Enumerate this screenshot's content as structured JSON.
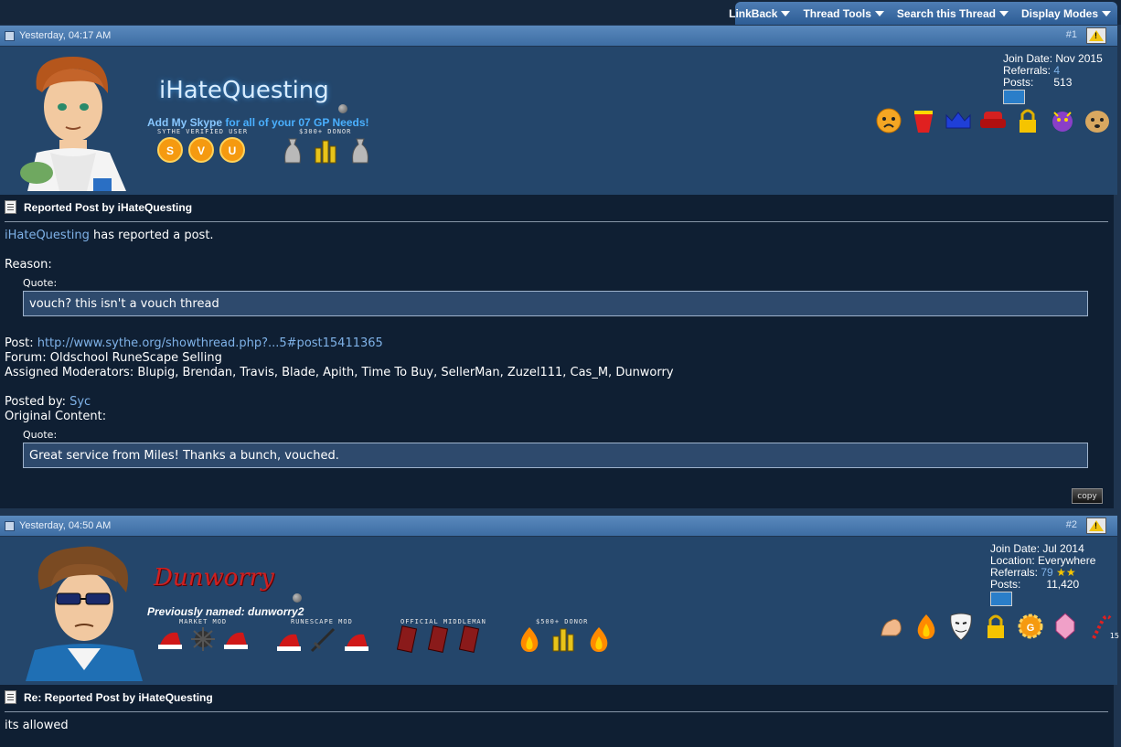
{
  "toolbar": {
    "items": [
      {
        "label": "LinkBack",
        "icon": "chevron-down-icon"
      },
      {
        "label": "Thread Tools",
        "icon": "chevron-down-icon"
      },
      {
        "label": "Search this Thread",
        "icon": "chevron-down-icon"
      },
      {
        "label": "Display Modes",
        "icon": "chevron-down-icon"
      }
    ]
  },
  "posts": [
    {
      "timestamp": "Yesterday, 04:17 AM",
      "number": "#1",
      "username": "iHateQuesting",
      "usertitle_parts": [
        "Add My Skype",
        " for all of your 07 GP Needs!"
      ],
      "badge_groups": [
        {
          "label": "SYTHE VERIFIED USER",
          "icons": [
            "sythe-s-badge-icon",
            "sythe-v-badge-icon",
            "sythe-u-badge-icon"
          ]
        },
        {
          "label": "$300+ DONOR",
          "icons": [
            "coin-bag-icon",
            "gold-coins-icon",
            "coin-bag-icon"
          ]
        }
      ],
      "stats": {
        "join_label": "Join Date:",
        "join_value": "Nov 2015",
        "referrals_label": "Referrals:",
        "referrals_value": "4",
        "posts_label": "Posts:",
        "posts_value": "513"
      },
      "award_icons": [
        "crying-face-icon",
        "bucket-icon",
        "crown-icon",
        "armchair-icon",
        "padlock-icon",
        "dragon-icon",
        "doge-icon"
      ],
      "title": "Reported Post by iHateQuesting",
      "reporter": "iHateQuesting",
      "reported_text": " has reported a post.",
      "reason_label": "Reason:",
      "quote_label_1": "Quote:",
      "reason_quote": "vouch? this isn't a vouch thread",
      "post_label": "Post: ",
      "post_link": "http://www.sythe.org/showthread.php?...5#post15411365",
      "forum_line": "Forum: Oldschool RuneScape Selling",
      "moderators_line": "Assigned Moderators: Blupig, Brendan, Travis, Blade, Apith, Time To Buy, SellerMan, Zuzel111, Cas_M, Dunworry",
      "posted_by_label": "Posted by: ",
      "posted_by_user": "Syc",
      "original_label": "Original Content:",
      "quote_label_2": "Quote:",
      "original_quote": "Great service from Miles! Thanks a bunch, vouched.",
      "copy_label": "copy"
    },
    {
      "timestamp": "Yesterday, 04:50 AM",
      "number": "#2",
      "username": "Dunworry",
      "previously_named": "Previously named: dunworry2",
      "badge_groups": [
        {
          "label": "MARKET MOD",
          "icons": [
            "santa-hat-icon",
            "spiked-ball-icon",
            "santa-hat-icon"
          ]
        },
        {
          "label": "RUNESCAPE MOD",
          "icons": [
            "santa-hat-icon",
            "sword-icon",
            "santa-hat-icon"
          ]
        },
        {
          "label": "OFFICIAL MIDDLEMAN",
          "icons": [
            "book-icon",
            "book-icon",
            "book-icon"
          ]
        },
        {
          "label": "$500+ DONOR",
          "icons": [
            "flame-icon",
            "gold-coins-icon",
            "flame-icon"
          ]
        }
      ],
      "stats": {
        "join_label": "Join Date:",
        "join_value": "Jul 2014",
        "location_label": "Location:",
        "location_value": "Everywhere",
        "referrals_label": "Referrals:",
        "referrals_value": "79",
        "posts_label": "Posts:",
        "posts_value": "11,420"
      },
      "award_icons": [
        "flexed-arm-icon",
        "flame-icon",
        "guy-fawkes-mask-icon",
        "padlock-icon",
        "gear-badge-icon",
        "gem-icon",
        "candy-cane-icon"
      ],
      "award_count": "15",
      "title": "Re: Reported Post by iHateQuesting",
      "body": "its allowed"
    }
  ],
  "colors": {
    "link": "#7fb2e8",
    "header": "#4b7bb0",
    "content_bg": "#0f1f33",
    "userbar_bg": "#24466b"
  }
}
